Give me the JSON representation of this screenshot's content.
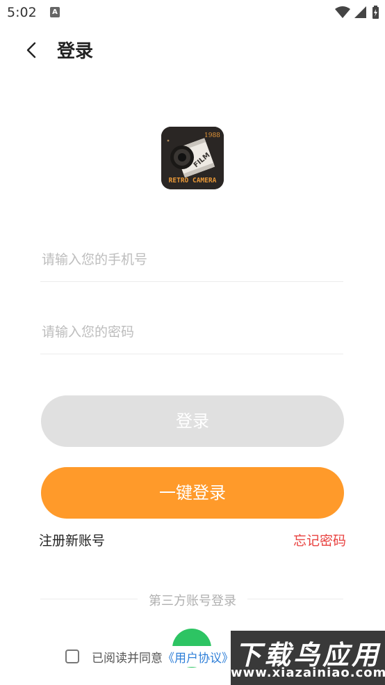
{
  "status_bar": {
    "time": "5:02",
    "notification_icon": "A"
  },
  "header": {
    "title": "登录"
  },
  "logo": {
    "year_text": "1988",
    "film_text": "FILM",
    "brand_text": "RETRO CAMERA"
  },
  "form": {
    "phone_placeholder": "请输入您的手机号",
    "password_placeholder": "请输入您的密码",
    "login_label": "登录",
    "one_key_login_label": "一键登录",
    "register_label": "注册新账号",
    "forgot_label": "忘记密码"
  },
  "third_party": {
    "title": "第三方账号登录"
  },
  "agreement": {
    "prefix": "已阅读并同意",
    "user_agreement_link": "《用户协议》"
  },
  "watermark": {
    "title": "下载鸟应用",
    "url": "www.xiazainiao.com"
  },
  "colors": {
    "accent": "#ff9a2a",
    "disabled_button": "#e0e0e0",
    "forgot_link": "#e8413f",
    "agreement_link": "#2f7fd8",
    "wechat_green": "#2dc463"
  }
}
